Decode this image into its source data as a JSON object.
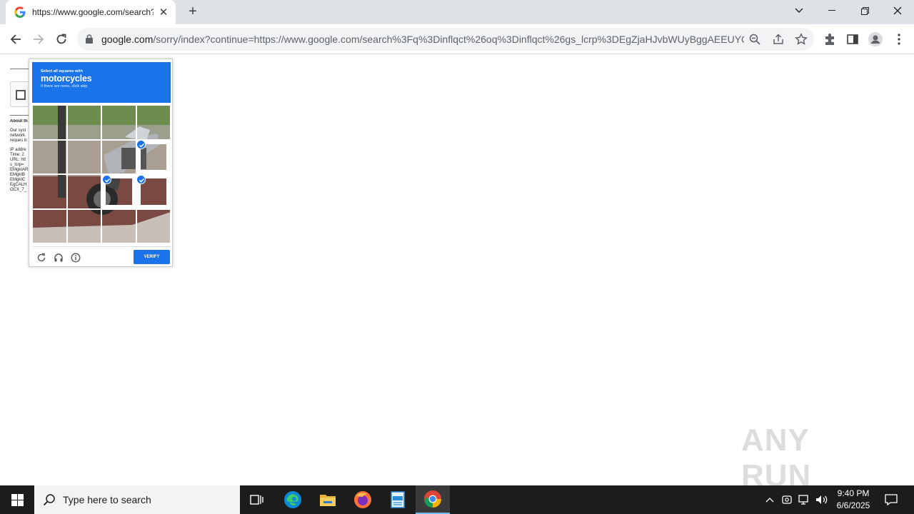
{
  "browser": {
    "tab_title": "https://www.google.com/search?q=inflqct",
    "tab_close": "✕",
    "new_tab": "+",
    "url_domain": "google.com",
    "url_path": "/sorry/index?continue=https://www.google.com/search%3Fq%3Dinflqct%26oq%3Dinflqct%26gs_lcrp%3DEgZjaHJvbWUyBggAEEUYOT..."
  },
  "page": {
    "about_heading": "About th",
    "about_text": [
      "Our syst",
      "network.",
      "reques b"
    ],
    "details": [
      "IP addre",
      "Time: 2",
      "URL: htt",
      "s_lcrp=",
      "EMgkIAR",
      "EMgkIB",
      "EMgkIC",
      "EgCALH",
      "OCX_7_"
    ]
  },
  "captcha": {
    "instruction": "Select all squares with",
    "target": "motorcycles",
    "hint": "If there are none, click skip",
    "verify_label": "VERIFY",
    "selected_tiles": [
      [
        1,
        3
      ],
      [
        2,
        2
      ],
      [
        2,
        3
      ]
    ]
  },
  "watermark": "ANY RUN",
  "taskbar": {
    "search_placeholder": "Type here to search",
    "time": "9:40 PM",
    "date": "6/6/2025"
  }
}
